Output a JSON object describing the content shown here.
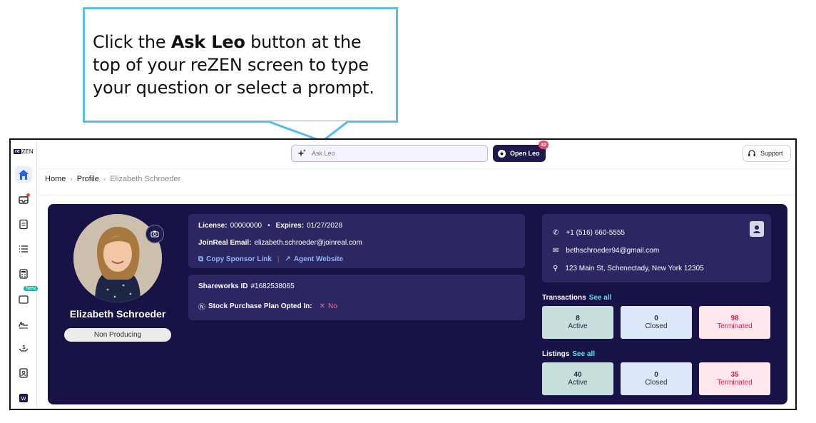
{
  "callout": {
    "prefix": "Click the ",
    "bold": "Ask Leo",
    "suffix": " button at the top of your reZEN screen to type your question or select a prompt."
  },
  "app": {
    "logo": {
      "box": "re",
      "text": "ZEN"
    },
    "search_placeholder": "Ask Leo",
    "open_leo_label": "Open Leo",
    "open_leo_count": "32",
    "support_label": "Support",
    "new_badge": "New",
    "accent_color": "#171347"
  },
  "breadcrumb": {
    "home": "Home",
    "profile": "Profile",
    "current": "Elizabeth Schroeder"
  },
  "profile": {
    "name": "Elizabeth Schroeder",
    "status": "Non Producing",
    "license_label": "License:",
    "license_value": "00000000",
    "bullet": "•",
    "expires_label": "Expires:",
    "expires_value": "01/27/2028",
    "email_label": "JoinReal Email:",
    "email_value": "elizabeth.schroeder@joinreal.com",
    "copy_sponsor": "Copy Sponsor Link",
    "agent_website": "Agent Website",
    "shareworks_label": "Shareworks ID",
    "shareworks_value": "#1682538065",
    "stock_label": "Stock Purchase Plan Opted In:",
    "stock_value": "No"
  },
  "contact": {
    "phone": "+1 (516) 660-5555",
    "email": "bethschroeder94@gmail.com",
    "address": "123 Main St, Schenectady, New York 12305"
  },
  "transactions": {
    "title": "Transactions",
    "see_all": "See all",
    "active": {
      "value": "8",
      "label": "Active"
    },
    "closed": {
      "value": "0",
      "label": "Closed"
    },
    "terminated": {
      "value": "98",
      "label": "Terminated"
    }
  },
  "listings": {
    "title": "Listings",
    "see_all": "See all",
    "active": {
      "value": "40",
      "label": "Active"
    },
    "closed": {
      "value": "0",
      "label": "Closed"
    },
    "terminated": {
      "value": "35",
      "label": "Terminated"
    }
  }
}
